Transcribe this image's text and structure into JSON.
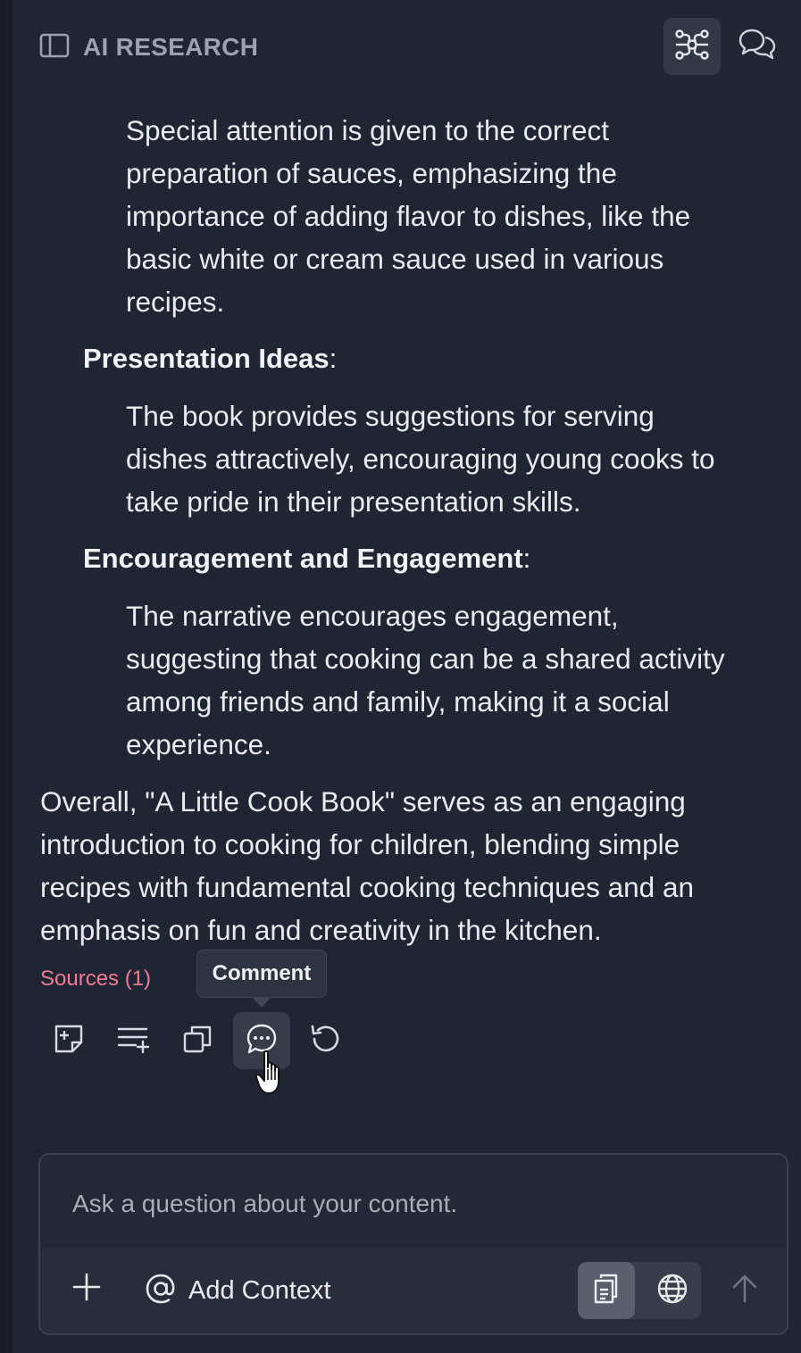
{
  "header": {
    "title": "AI RESEARCH",
    "icons": [
      "sidebar-toggle-icon",
      "mind-map-icon",
      "chat-bubbles-icon"
    ]
  },
  "content": {
    "p1_lines": [
      "Special attention is given to the correct",
      "preparation of sauces, emphasizing the",
      "importance of adding flavor to dishes, like the",
      "basic white or cream sauce used in various",
      "recipes."
    ],
    "h1": "Presentation Ideas",
    "h1_suffix": ":",
    "p2_lines": [
      "The book provides suggestions for serving",
      "dishes attractively, encouraging young cooks to",
      "take pride in their presentation skills."
    ],
    "h2": "Encouragement and Engagement",
    "h2_suffix": ":",
    "p3_lines": [
      "The narrative encourages engagement,",
      "suggesting that cooking can be a shared activity",
      "among friends and family, making it a social",
      "experience."
    ],
    "summary_lines": [
      "Overall, \"A Little Cook Book\" serves as an engaging",
      "introduction to cooking for children, blending simple",
      "recipes with fundamental cooking techniques and an",
      "emphasis on fun and creativity in the kitchen."
    ],
    "sources_label": "Sources (1)"
  },
  "actions": {
    "tooltip": "Comment",
    "icons": [
      "add-note-icon",
      "add-to-list-icon",
      "copy-icon",
      "comment-icon",
      "regenerate-icon"
    ]
  },
  "composer": {
    "placeholder": "Ask a question about your content.",
    "value": "",
    "add_context_label": "Add Context",
    "modes": [
      "documents-mode-icon",
      "web-mode-icon"
    ]
  },
  "colors": {
    "background": "#1f2533",
    "accent_pink": "#ee7a93",
    "text": "#e9ebef"
  }
}
